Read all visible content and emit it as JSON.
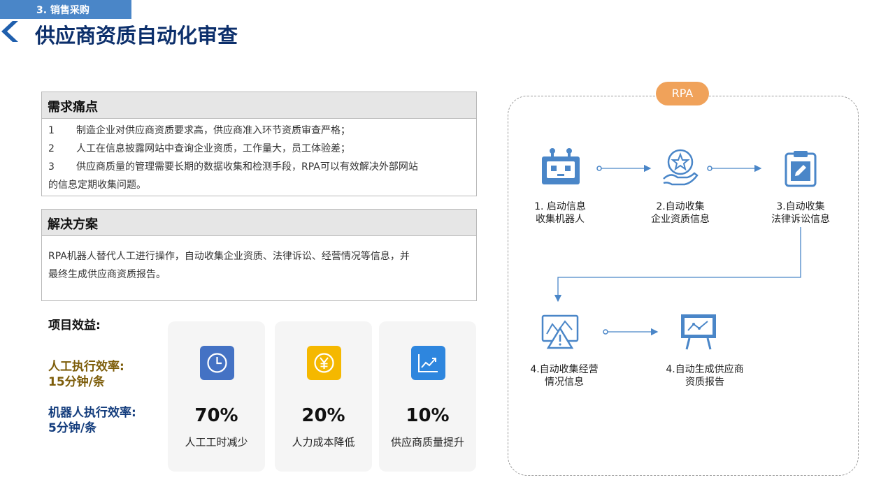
{
  "header": {
    "section_tag": "3. 销售采购",
    "title": "供应商资质自动化审查"
  },
  "pain_points": {
    "title": "需求痛点",
    "items": [
      {
        "num": "1",
        "text": "制造企业对供应商资质要求高，供应商准入环节资质审查严格；"
      },
      {
        "num": "2",
        "text": "人工在信息披露网站中查询企业资质，工作量大，员工体验差；"
      },
      {
        "num": "3",
        "text": "供应商质量的管理需要长期的数据收集和检测手段，RPA可以有效解决外部网站"
      }
    ],
    "item3_cont": "的信息定期收集问题。"
  },
  "solution": {
    "title": "解决方案",
    "line1": "RPA机器人替代人工进行操作，自动收集企业资质、法律诉讼、经营情况等信息，并",
    "line2": "最终生成供应商资质报告。"
  },
  "benefits": {
    "title": "项目效益:",
    "manual_label": "人工执行效率:",
    "manual_value": "15分钟/条",
    "robot_label": "机器人执行效率:",
    "robot_value": "5分钟/条",
    "cards": [
      {
        "icon": "clock-icon",
        "color": "#4472c4",
        "percent": "70%",
        "label": "人工工时减少"
      },
      {
        "icon": "yen-coin-icon",
        "color": "#f5b800",
        "percent": "20%",
        "label": "人力成本降低"
      },
      {
        "icon": "trend-chart-icon",
        "color": "#2e86de",
        "percent": "10%",
        "label": "供应商质量提升"
      }
    ]
  },
  "flow": {
    "badge": "RPA",
    "accent": "#4a86c8",
    "steps": [
      {
        "icon": "robot-icon",
        "line1": "1. 启动信息",
        "line2": "收集机器人"
      },
      {
        "icon": "award-hand-icon",
        "line1": "2.自动收集",
        "line2": "企业资质信息"
      },
      {
        "icon": "clipboard-edit-icon",
        "line1": "3.自动收集",
        "line2": "法律诉讼信息"
      },
      {
        "icon": "warning-chart-icon",
        "line1": "4.自动收集经营",
        "line2": "情况信息"
      },
      {
        "icon": "presentation-board-icon",
        "line1": "4.自动生成供应商",
        "line2": "资质报告"
      }
    ]
  }
}
